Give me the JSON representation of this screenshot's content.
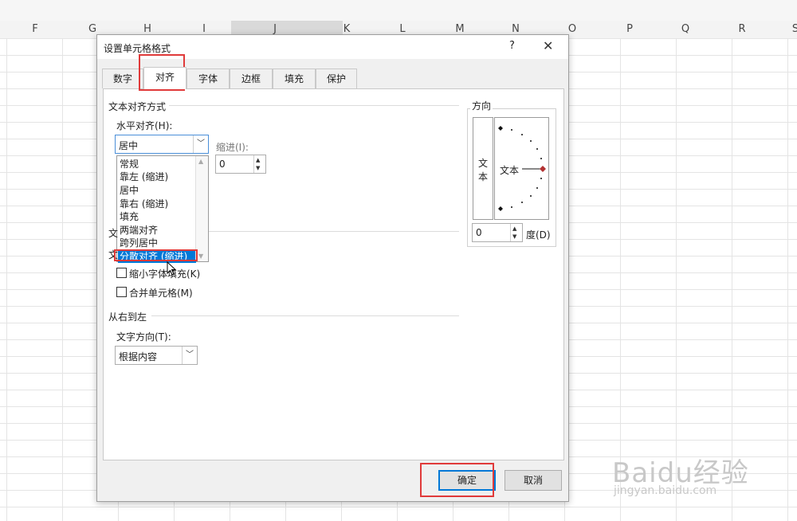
{
  "sheet": {
    "columns": [
      "F",
      "G",
      "H",
      "I",
      "J",
      "K",
      "L",
      "M",
      "N",
      "O",
      "P",
      "Q",
      "R",
      "S"
    ]
  },
  "dialog": {
    "title": "设置单元格格式",
    "help_icon": "?",
    "close_icon": "✕",
    "tabs": [
      {
        "label": "数字"
      },
      {
        "label": "对齐"
      },
      {
        "label": "字体"
      },
      {
        "label": "边框"
      },
      {
        "label": "填充"
      },
      {
        "label": "保护"
      }
    ],
    "active_tab": "对齐",
    "text_alignment": {
      "section_title": "文本对齐方式",
      "horizontal_label": "水平对齐(H):",
      "horizontal_value": "居中",
      "horizontal_options": [
        "常规",
        "靠左 (缩进)",
        "居中",
        "靠右 (缩进)",
        "填充",
        "两端对齐",
        "跨列居中",
        "分散对齐 (缩进)"
      ],
      "highlighted_option": "分散对齐 (缩进)",
      "indent_label": "缩进(I):",
      "indent_value": "0",
      "partial_label_1": "文",
      "partial_label_2": "文"
    },
    "text_control": {
      "shrink_label": "缩小字体填充(K)",
      "merge_label": "合并单元格(M)"
    },
    "rtl": {
      "section_title": "从右到左",
      "direction_label": "文字方向(T):",
      "direction_value": "根据内容"
    },
    "orientation": {
      "section_title": "方向",
      "vertical_chars": [
        "文",
        "本"
      ],
      "dial_text": "文本",
      "degree_value": "0",
      "degree_label": "度(D)"
    },
    "buttons": {
      "ok": "确定",
      "cancel": "取消"
    }
  },
  "watermark": {
    "logo": "Baidu经验",
    "url": "jingyan.baidu.com"
  },
  "colors": {
    "highlight_red": "#e03a3a",
    "selection_blue": "#0078d7"
  }
}
